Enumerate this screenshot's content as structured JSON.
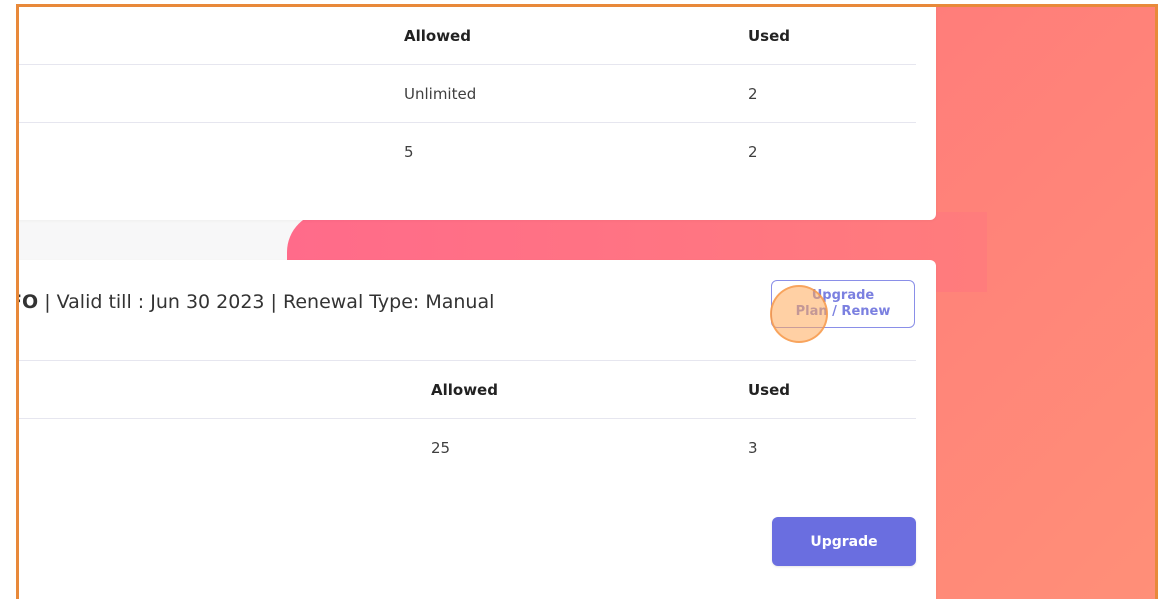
{
  "usage_table_1": {
    "headers": {
      "allowed": "Allowed",
      "used": "Used"
    },
    "rows": [
      {
        "allowed": "Unlimited",
        "used": "2"
      },
      {
        "allowed": "5",
        "used": "2"
      }
    ]
  },
  "plan_card": {
    "info_prefix": "FO",
    "info_rest": "| Valid till : Jun 30 2023 | Renewal Type: Manual",
    "upgrade_plan_line1": "Upgrade",
    "upgrade_plan_line2": "Plan / Renew",
    "table": {
      "headers": {
        "allowed": "Allowed",
        "used": "Used"
      },
      "rows": [
        {
          "allowed": "25",
          "used": "3"
        }
      ]
    },
    "upgrade_button": "Upgrade"
  },
  "colors": {
    "accent": "#6a6ee0",
    "outline_button": "#8a8fe8",
    "background_gradient_start": "#ff6b8a",
    "background_gradient_end": "#ff8f78",
    "frame_border": "#e8893a"
  }
}
